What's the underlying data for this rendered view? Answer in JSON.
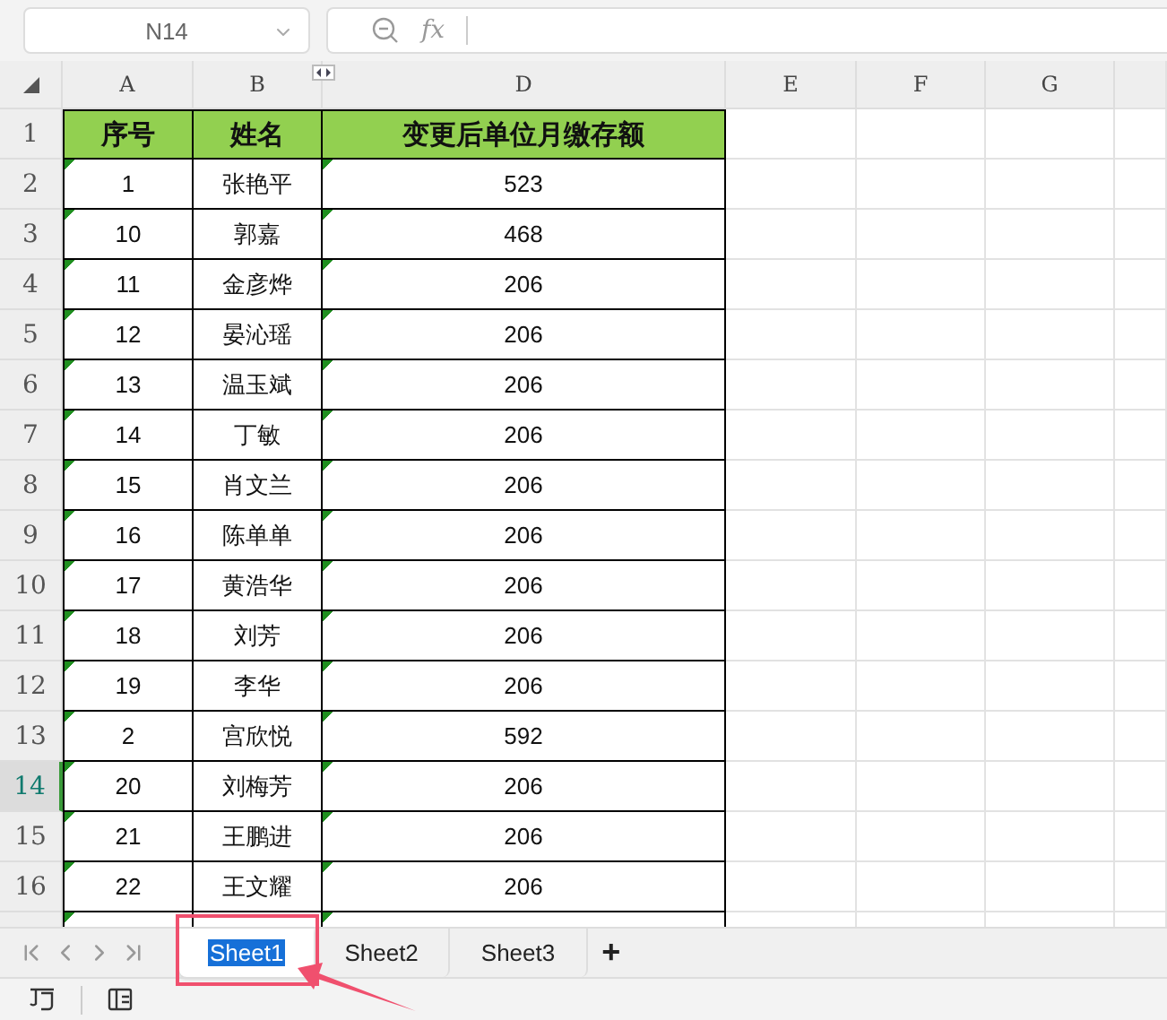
{
  "name_box": {
    "value": "N14"
  },
  "formula_bar": {
    "function_label": "fx"
  },
  "column_headers": [
    {
      "label": "A",
      "selected": false
    },
    {
      "label": "B",
      "selected": false
    },
    {
      "label": "D",
      "selected": false
    },
    {
      "label": "E",
      "selected": false
    },
    {
      "label": "F",
      "selected": false
    },
    {
      "label": "G",
      "selected": false
    }
  ],
  "rows": [
    {
      "header": "1",
      "selected": false,
      "kind": "heading",
      "cells": [
        "序号",
        "姓名",
        "变更后单位月缴存额"
      ]
    },
    {
      "header": "2",
      "selected": false,
      "kind": "data",
      "cells": [
        "1",
        "张艳平",
        "523"
      ]
    },
    {
      "header": "3",
      "selected": false,
      "kind": "data",
      "cells": [
        "10",
        "郭嘉",
        "468"
      ]
    },
    {
      "header": "4",
      "selected": false,
      "kind": "data",
      "cells": [
        "11",
        "金彦烨",
        "206"
      ]
    },
    {
      "header": "5",
      "selected": false,
      "kind": "data",
      "cells": [
        "12",
        "晏沁瑶",
        "206"
      ]
    },
    {
      "header": "6",
      "selected": false,
      "kind": "data",
      "cells": [
        "13",
        "温玉斌",
        "206"
      ]
    },
    {
      "header": "7",
      "selected": false,
      "kind": "data",
      "cells": [
        "14",
        "丁敏",
        "206"
      ]
    },
    {
      "header": "8",
      "selected": false,
      "kind": "data",
      "cells": [
        "15",
        "肖文兰",
        "206"
      ]
    },
    {
      "header": "9",
      "selected": false,
      "kind": "data",
      "cells": [
        "16",
        "陈单单",
        "206"
      ]
    },
    {
      "header": "10",
      "selected": false,
      "kind": "data",
      "cells": [
        "17",
        "黄浩华",
        "206"
      ]
    },
    {
      "header": "11",
      "selected": false,
      "kind": "data",
      "cells": [
        "18",
        "刘芳",
        "206"
      ]
    },
    {
      "header": "12",
      "selected": false,
      "kind": "data",
      "cells": [
        "19",
        "李华",
        "206"
      ]
    },
    {
      "header": "13",
      "selected": false,
      "kind": "data",
      "cells": [
        "2",
        "宫欣悦",
        "592"
      ]
    },
    {
      "header": "14",
      "selected": true,
      "kind": "data",
      "cells": [
        "20",
        "刘梅芳",
        "206"
      ]
    },
    {
      "header": "15",
      "selected": false,
      "kind": "data",
      "cells": [
        "21",
        "王鹏进",
        "206"
      ]
    },
    {
      "header": "16",
      "selected": false,
      "kind": "data",
      "cells": [
        "22",
        "王文耀",
        "206"
      ]
    }
  ],
  "sheet_tabs": [
    {
      "label": "Sheet1",
      "selected": true
    },
    {
      "label": "Sheet2",
      "selected": false
    },
    {
      "label": "Sheet3",
      "selected": false
    }
  ],
  "add_sheet": "+"
}
